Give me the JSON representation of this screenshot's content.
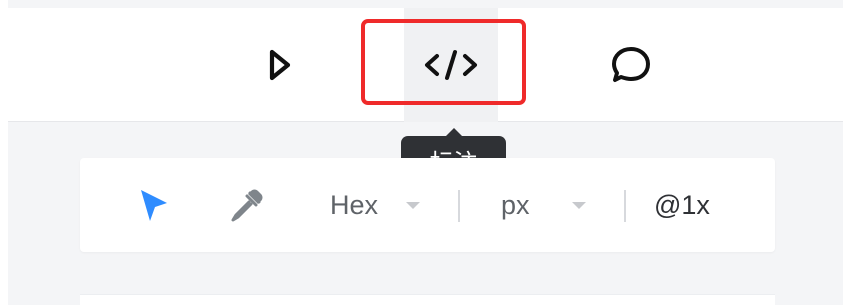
{
  "toolbar": {
    "buttons": [
      {
        "icon": "play-icon"
      },
      {
        "icon": "code-icon",
        "active": true
      },
      {
        "icon": "comment-icon"
      }
    ]
  },
  "tooltip": {
    "text": "标注"
  },
  "inspect_panel": {
    "tools": [
      {
        "icon": "pointer-icon",
        "active": true
      },
      {
        "icon": "eyedropper-icon"
      }
    ],
    "color_format": "Hex",
    "unit": "px",
    "scale": "@1x"
  },
  "colors": {
    "highlight": "#ef2a2a",
    "accent": "#2f8cff",
    "tooltip_bg": "#2f3135",
    "panel_bg": "#ffffff",
    "page_bg": "#f4f5f7"
  }
}
